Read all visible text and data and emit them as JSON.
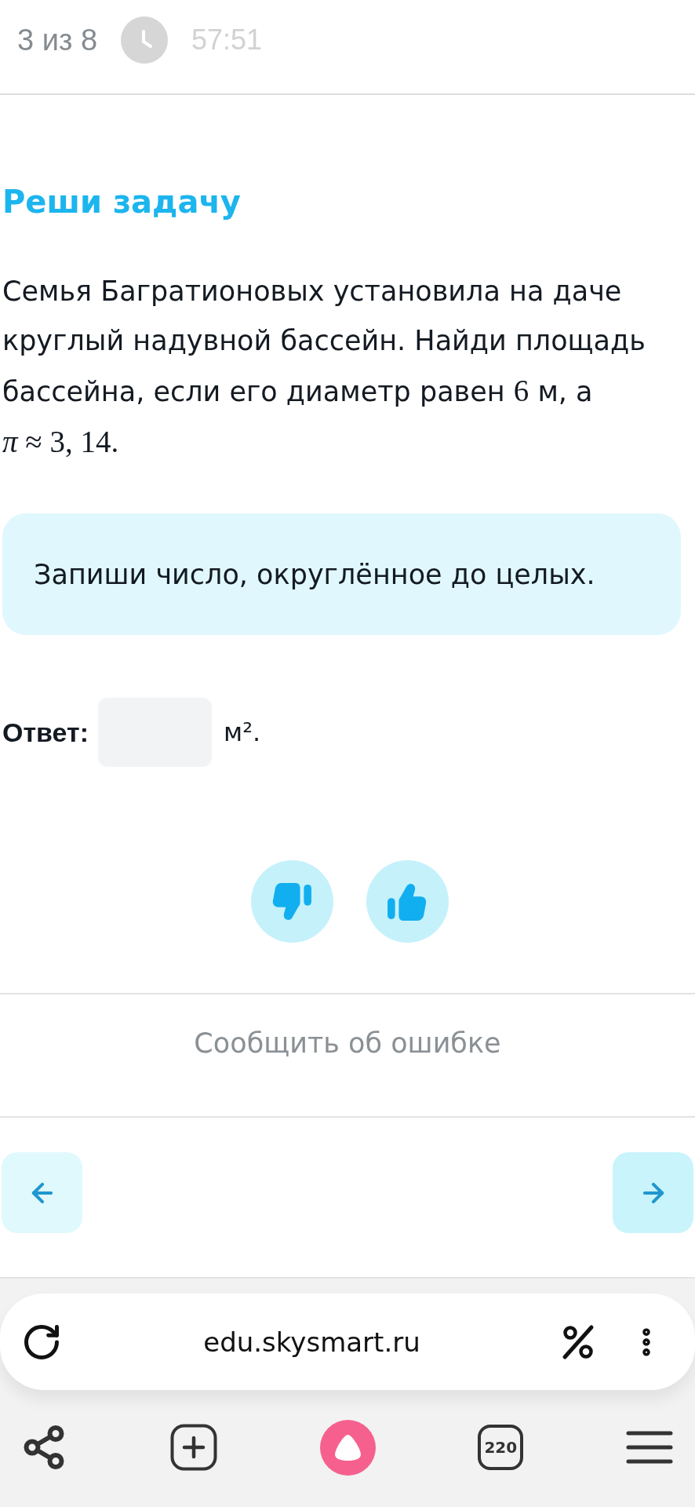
{
  "header": {
    "progress": "3 из 8",
    "timer": "57:51"
  },
  "task": {
    "title": "Реши задачу",
    "problem": [
      {
        "kind": "text",
        "text": "Семья Багратионовых установила на даче круглый надувной бассейн. Найди площадь бассейна, если его диаметр равен "
      },
      {
        "kind": "math",
        "text": "6"
      },
      {
        "kind": "text",
        "text": " м, а "
      },
      {
        "kind": "math",
        "text": "*π* ≈ 3, 14."
      }
    ],
    "hint": "Запиши число, округлённое до целых."
  },
  "answer": {
    "label": "Ответ:",
    "unit": "м²."
  },
  "report_link": "Сообщить об ошибке",
  "browser": {
    "url": "edu.skysmart.ru",
    "tab_count": "220"
  }
}
